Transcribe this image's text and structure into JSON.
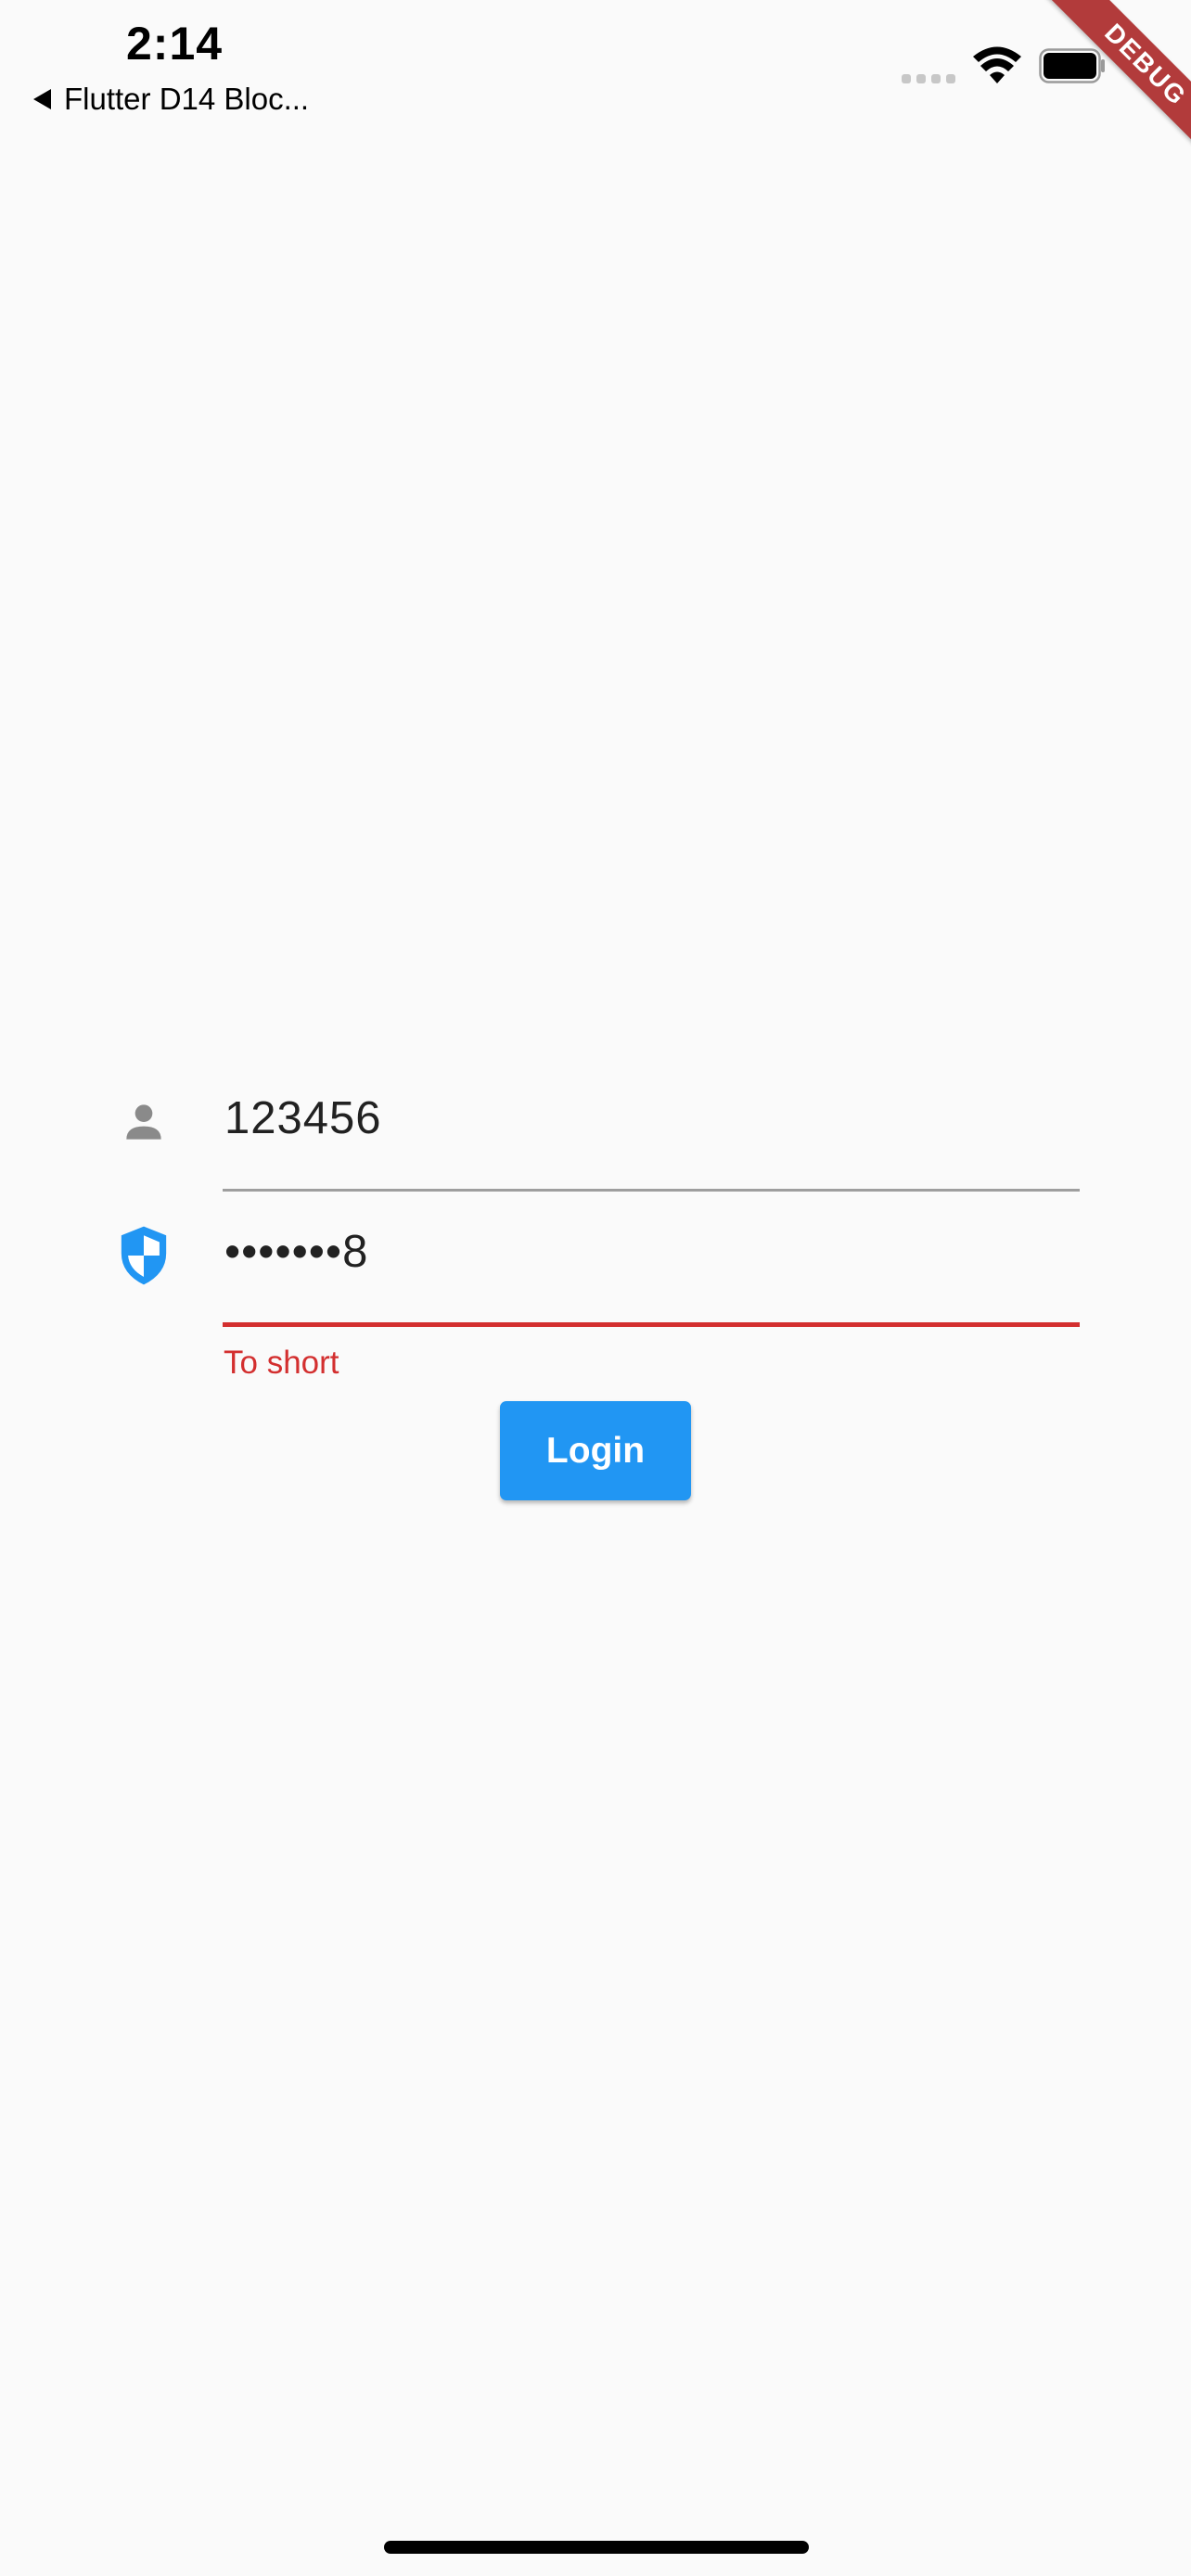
{
  "status_bar": {
    "time": "2:14",
    "back_app_label": "Flutter D14 Bloc..."
  },
  "debug_banner": {
    "label": "DEBUG"
  },
  "form": {
    "username": {
      "value": "123456",
      "icon": "person-icon"
    },
    "password": {
      "value": "•••••••8",
      "icon": "shield-icon",
      "error": "To short"
    },
    "login_label": "Login"
  },
  "colors": {
    "background": "#fafafa",
    "accent": "#2196f3",
    "error": "#d32f2f",
    "icon_grey": "#8a8a8a",
    "debug_ribbon": "#b23b3b"
  }
}
